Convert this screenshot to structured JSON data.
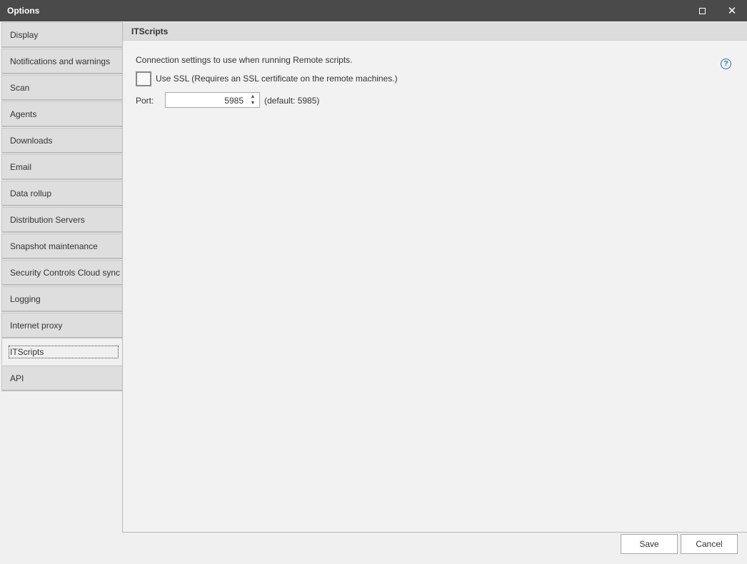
{
  "window": {
    "title": "Options",
    "maximize_icon": "maximize-icon",
    "close_icon": "close-icon",
    "close_glyph": "✕"
  },
  "sidebar": {
    "items": [
      {
        "label": "Display"
      },
      {
        "label": "Notifications and warnings"
      },
      {
        "label": "Scan"
      },
      {
        "label": "Agents"
      },
      {
        "label": "Downloads"
      },
      {
        "label": "Email"
      },
      {
        "label": "Data rollup"
      },
      {
        "label": "Distribution Servers"
      },
      {
        "label": "Snapshot maintenance"
      },
      {
        "label": "Security Controls Cloud sync"
      },
      {
        "label": "Logging"
      },
      {
        "label": "Internet proxy"
      },
      {
        "label": "ITScripts",
        "selected": true
      },
      {
        "label": "API"
      }
    ]
  },
  "panel": {
    "header": "ITScripts",
    "description": "Connection settings to use when running Remote scripts.",
    "ssl_checkbox": {
      "label": "Use SSL (Requires an SSL certificate on the remote machines.)",
      "checked": false
    },
    "port": {
      "label": "Port:",
      "value": "5985",
      "default_text": "(default: 5985)"
    },
    "help_glyph": "?"
  },
  "footer": {
    "save_label": "Save",
    "cancel_label": "Cancel"
  },
  "colors": {
    "titlebar": "#4a4a4a",
    "accent": "#2a6fc0"
  }
}
